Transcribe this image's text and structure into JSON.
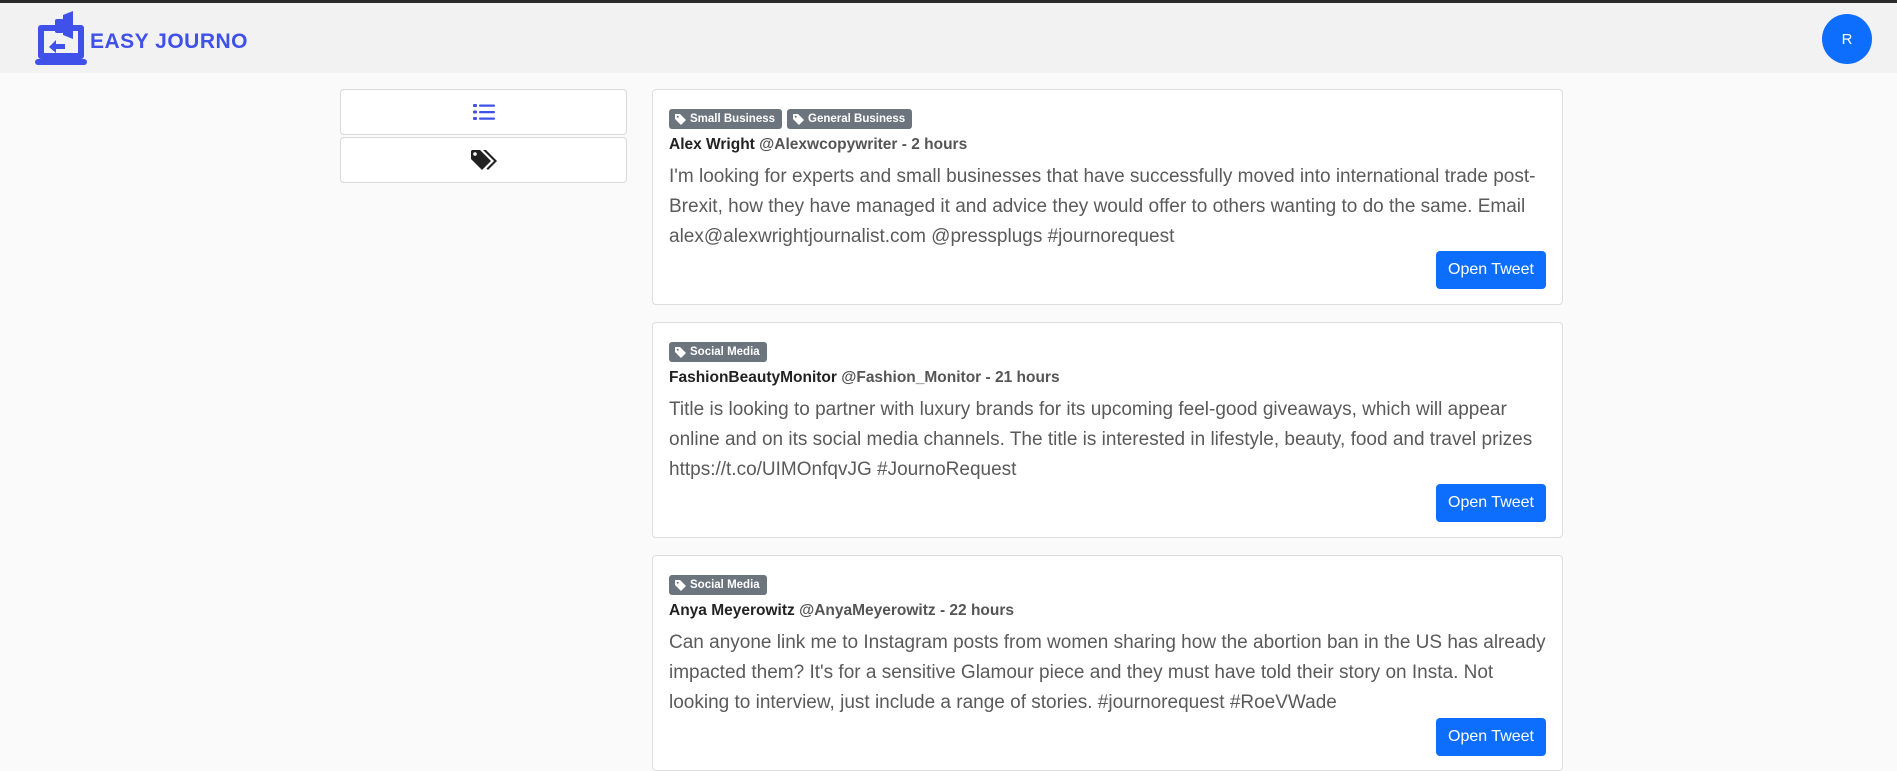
{
  "app": {
    "brand_name": "EASY JOURNO"
  },
  "user": {
    "avatar_initial": "R"
  },
  "sidebar": {
    "list_icon": "list-icon",
    "tags_icon": "tags-icon"
  },
  "colors": {
    "brand": "#3f51e8",
    "primary": "#0d6efd",
    "badge": "#6c757d"
  },
  "posts": [
    {
      "tags": [
        "Small Business",
        "General Business"
      ],
      "author": "Alex Wright",
      "meta": "@Alexwcopywriter - 2 hours",
      "text": "I'm looking for experts and small businesses that have successfully moved into international trade post-Brexit, how they have managed it and advice they would offer to others wanting to do the same. Email alex@alexwrightjournalist.com @pressplugs #journorequest",
      "button": "Open Tweet"
    },
    {
      "tags": [
        "Social Media"
      ],
      "author": "FashionBeautyMonitor",
      "meta": "@Fashion_Monitor - 21 hours",
      "text": "Title is looking to partner with luxury brands for its upcoming feel-good giveaways, which will appear online and on its social media channels. The title is interested in lifestyle, beauty, food and travel prizes https://t.co/UIMOnfqvJG #JournoRequest",
      "button": "Open Tweet"
    },
    {
      "tags": [
        "Social Media"
      ],
      "author": "Anya Meyerowitz",
      "meta": "@AnyaMeyerowitz - 22 hours",
      "text": "Can anyone link me to Instagram posts from women sharing how the abortion ban in the US has already impacted them? It's for a sensitive Glamour piece and they must have told their story on Insta. Not looking to interview, just include a range of stories. #journorequest #RoeVWade",
      "button": "Open Tweet"
    }
  ]
}
